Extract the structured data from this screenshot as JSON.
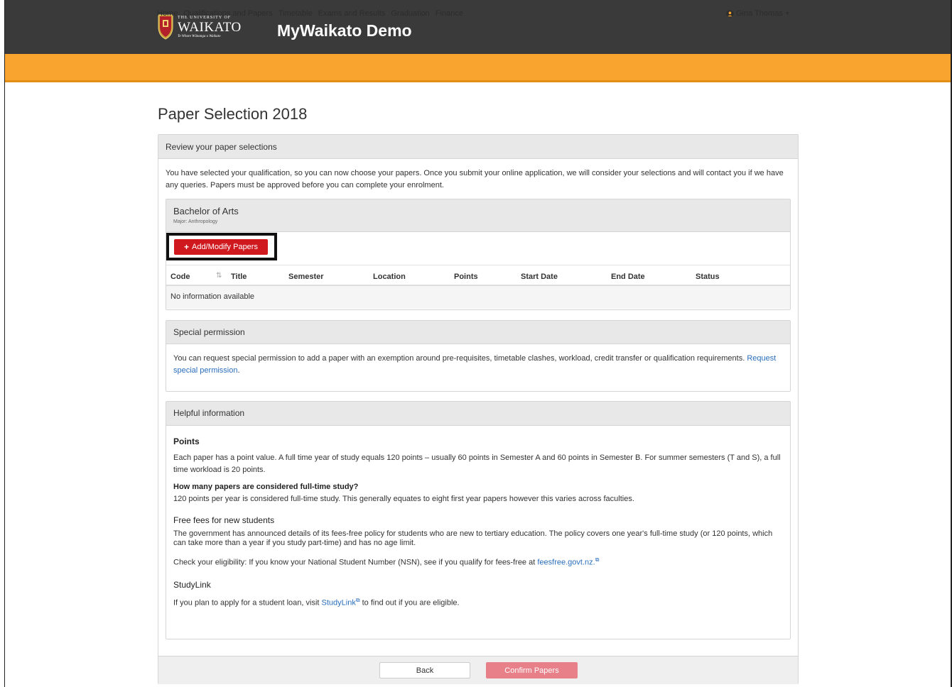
{
  "header": {
    "logo_line1": "THE UNIVERSITY OF",
    "logo_line2": "WAIKATO",
    "logo_line3": "Te Whare Wānanga o Waikato",
    "app_title": "MyWaikato Demo"
  },
  "nav": {
    "items": [
      "Home",
      "Qualifications and Papers",
      "Timetable",
      "Exams and Results",
      "Graduation",
      "Finance"
    ],
    "user_name": "Gina Thomas"
  },
  "page": {
    "title": "Paper Selection 2018",
    "panel_title": "Review your paper selections",
    "intro": "You have selected your qualification, so you can now choose your papers. Once you submit your online application, we will consider your selections and will contact you if we have any queries. Papers must be approved before you can complete your enrolment."
  },
  "qualification": {
    "name": "Bachelor of Arts",
    "major": "Major: Anthropology",
    "add_button": "Add/Modify Papers",
    "columns": [
      "Code",
      "Title",
      "Semester",
      "Location",
      "Points",
      "Start Date",
      "End Date",
      "Status"
    ],
    "empty_text": "No information available"
  },
  "special": {
    "title": "Special permission",
    "text": "You can request special permission to add a paper with an exemption around pre-requisites, timetable clashes, workload, credit transfer or qualification requirements.",
    "link": "Request special permission",
    "after_link": "."
  },
  "helpful": {
    "title": "Helpful information",
    "points_heading": "Points",
    "points_text": "Each paper has a point value. A full time year of study equals 120 points – usually 60 points in Semester A and 60 points in Semester B. For summer semesters (T and S), a full time workload is 20 points.",
    "fulltime_heading": "How many papers are considered full-time study?",
    "fulltime_text": "120 points per year is considered full-time study. This generally equates to eight first year papers however this varies across faculties.",
    "fees_heading": "Free fees for new students",
    "fees_text": "The government has announced details of its fees-free policy for students who are new to tertiary education. The policy covers one year's full-time study (or 120 points, which can take more than a year if you study part-time) and has no age limit.",
    "eligibility_text": "Check your eligibility: If you know your National Student Number (NSN), see if you qualify for fees-free at",
    "eligibility_link": "feesfree.govt.nz.",
    "studylink_heading": "StudyLink",
    "studylink_before": "If you plan to apply for a student loan, visit",
    "studylink_link": "StudyLink",
    "studylink_after": "to find out if you are eligible."
  },
  "footer": {
    "back": "Back",
    "confirm": "Confirm Papers"
  }
}
